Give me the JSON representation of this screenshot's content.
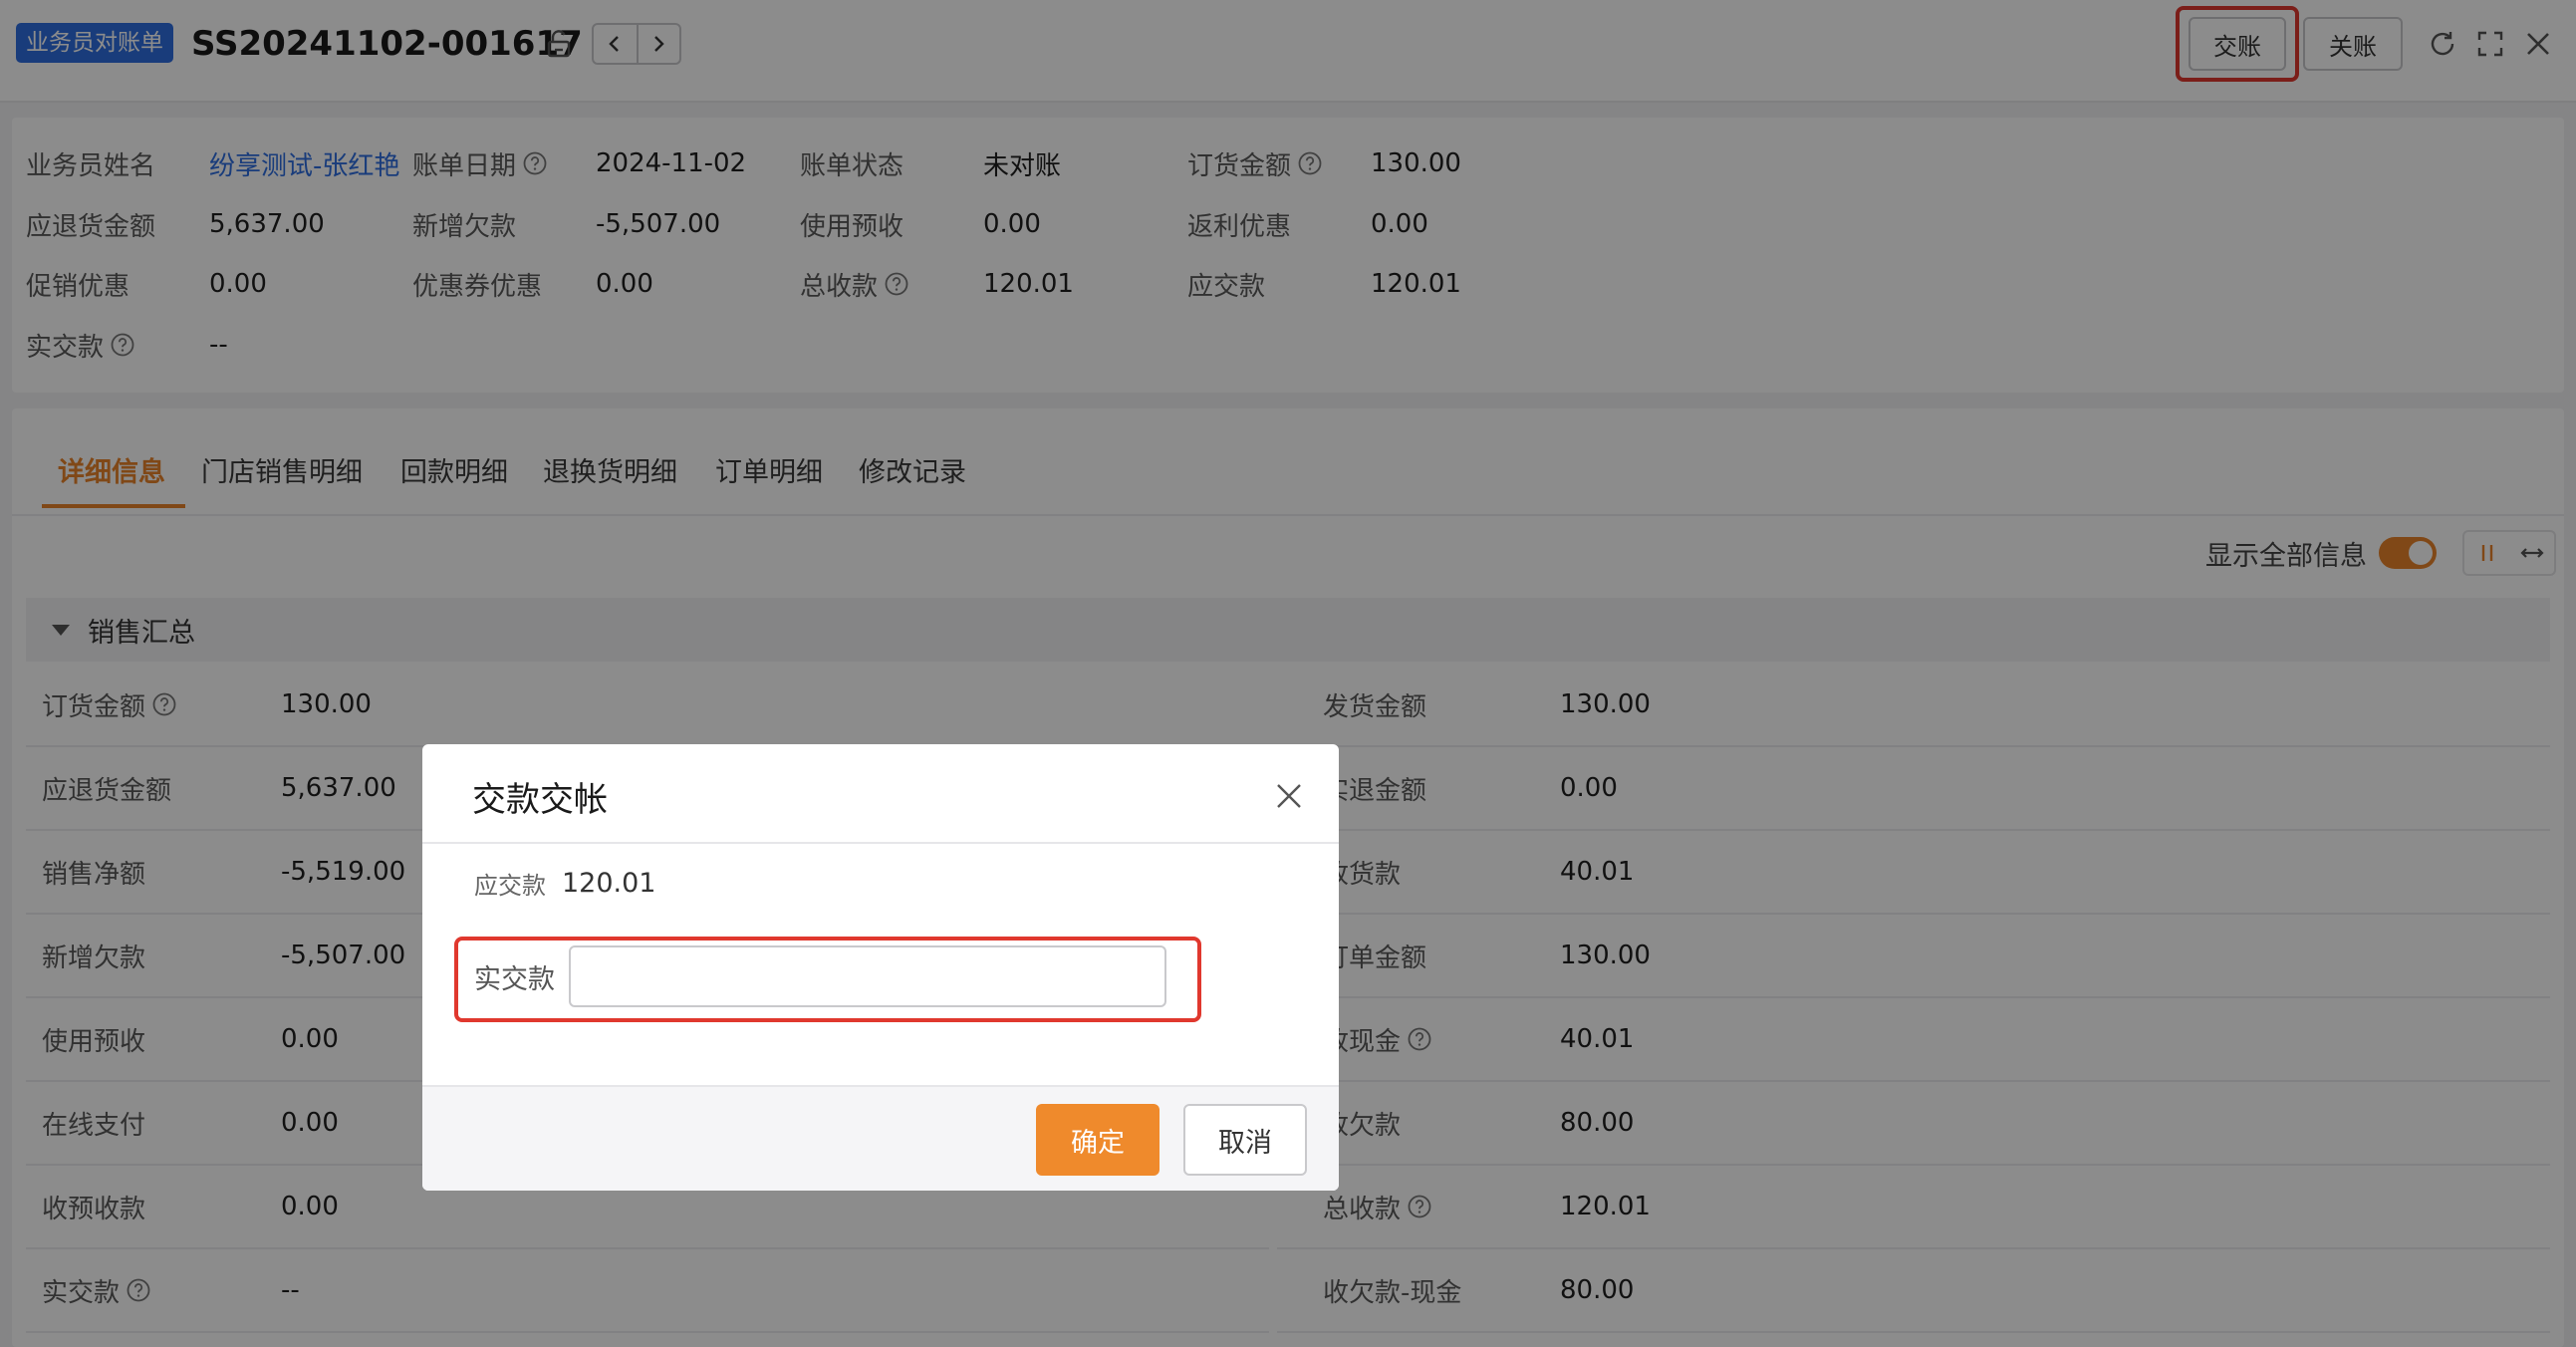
{
  "header": {
    "doc_type_badge": "业务员对账单",
    "doc_number": "SS20241102-001617",
    "btn_submit": "交账",
    "btn_close_account": "关账"
  },
  "info": {
    "rows": [
      [
        {
          "label": "业务员姓名",
          "value": "纷享测试-张红艳",
          "help": false,
          "link": true
        },
        {
          "label": "账单日期",
          "value": "2024-11-02",
          "help": true,
          "link": false
        },
        {
          "label": "账单状态",
          "value": "未对账",
          "help": false,
          "link": false
        },
        {
          "label": "订货金额",
          "value": "130.00",
          "help": true,
          "link": false
        }
      ],
      [
        {
          "label": "应退货金额",
          "value": "5,637.00",
          "help": false,
          "link": false
        },
        {
          "label": "新增欠款",
          "value": "-5,507.00",
          "help": false,
          "link": false
        },
        {
          "label": "使用预收",
          "value": "0.00",
          "help": false,
          "link": false
        },
        {
          "label": "返利优惠",
          "value": "0.00",
          "help": false,
          "link": false
        }
      ],
      [
        {
          "label": "促销优惠",
          "value": "0.00",
          "help": false,
          "link": false
        },
        {
          "label": "优惠券优惠",
          "value": "0.00",
          "help": false,
          "link": false
        },
        {
          "label": "总收款",
          "value": "120.01",
          "help": true,
          "link": false
        },
        {
          "label": "应交款",
          "value": "120.01",
          "help": false,
          "link": false
        }
      ],
      [
        {
          "label": "实交款",
          "value": "--",
          "help": true,
          "link": false
        }
      ]
    ]
  },
  "tabs": [
    "详细信息",
    "门店销售明细",
    "回款明细",
    "退换货明细",
    "订单明细",
    "修改记录"
  ],
  "toolbar": {
    "show_all_label": "显示全部信息",
    "show_all_on": true
  },
  "section": {
    "title": "销售汇总",
    "left_fields": [
      {
        "label": "订货金额",
        "value": "130.00",
        "help": true
      },
      {
        "label": "应退货金额",
        "value": "5,637.00",
        "help": false
      },
      {
        "label": "销售净额",
        "value": "-5,519.00",
        "help": false
      },
      {
        "label": "新增欠款",
        "value": "-5,507.00",
        "help": false
      },
      {
        "label": "使用预收",
        "value": "0.00",
        "help": false
      },
      {
        "label": "在线支付",
        "value": "0.00",
        "help": false
      },
      {
        "label": "收预收款",
        "value": "0.00",
        "help": false
      },
      {
        "label": "实交款",
        "value": "--",
        "help": true
      }
    ],
    "right_fields": [
      {
        "label": "发货金额",
        "value": "130.00",
        "help": false
      },
      {
        "label": "实退金额",
        "value": "0.00",
        "help": false
      },
      {
        "label": "收货款",
        "value": "40.01",
        "help": false
      },
      {
        "label": "订单金额",
        "value": "130.00",
        "help": false
      },
      {
        "label": "收现金",
        "value": "40.01",
        "help": true
      },
      {
        "label": "收欠款",
        "value": "80.00",
        "help": false
      },
      {
        "label": "总收款",
        "value": "120.01",
        "help": true
      },
      {
        "label": "收欠款-现金",
        "value": "80.00",
        "help": false
      }
    ]
  },
  "modal": {
    "title": "交款交帐",
    "due_label": "应交款",
    "due_value": "120.01",
    "paid_label": "实交款",
    "paid_value": "",
    "ok_label": "确定",
    "cancel_label": "取消"
  },
  "colors": {
    "accent": "#e9832b",
    "brand_blue": "#2f6ee0",
    "highlight_red": "#e0382e"
  }
}
